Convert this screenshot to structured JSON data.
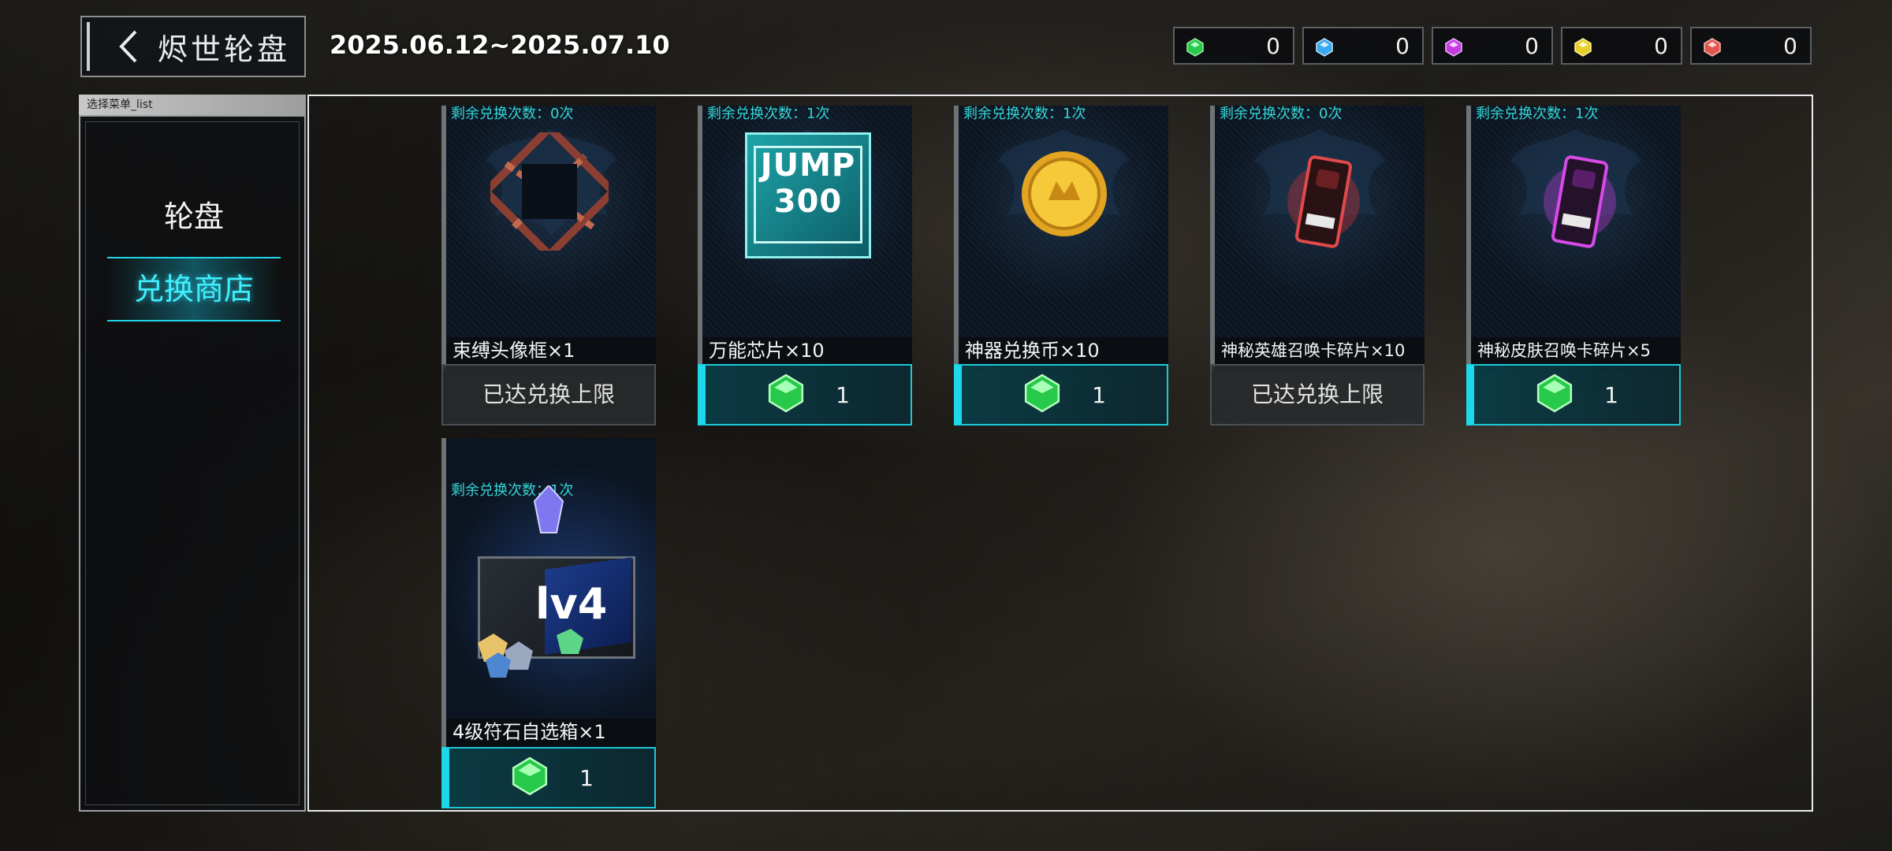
{
  "header": {
    "title": "烬世轮盘",
    "date_range": "2025.06.12~2025.07.10"
  },
  "currencies": [
    {
      "icon": "green-gem-icon",
      "color": "#27c94a",
      "value": "0"
    },
    {
      "icon": "blue-gem-icon",
      "color": "#3aa8f0",
      "value": "0"
    },
    {
      "icon": "purple-gem-icon",
      "color": "#c43ddc",
      "value": "0"
    },
    {
      "icon": "yellow-gem-icon",
      "color": "#e6cf2a",
      "value": "0"
    },
    {
      "icon": "red-gem-icon",
      "color": "#e0564f",
      "value": "0"
    }
  ],
  "sidebar": {
    "header": "选择菜单_list",
    "items": [
      {
        "label": "轮盘",
        "active": false
      },
      {
        "label": "兑换商店",
        "active": true
      }
    ]
  },
  "shop": {
    "items": [
      {
        "name": "束缚头像框×1",
        "remaining": "剩余兑换次数：0次",
        "button": "已达兑换上限",
        "price": null
      },
      {
        "name": "万能芯片×10",
        "remaining": "剩余兑换次数：1次",
        "button": null,
        "price": "1",
        "art_text": "JUMP 300"
      },
      {
        "name": "神器兑换币×10",
        "remaining": "剩余兑换次数：1次",
        "button": null,
        "price": "1"
      },
      {
        "name": "神秘英雄召唤卡碎片×10",
        "remaining": "剩余兑换次数：0次",
        "button": "已达兑换上限",
        "price": null
      },
      {
        "name": "神秘皮肤召唤卡碎片×5",
        "remaining": "剩余兑换次数：1次",
        "button": null,
        "price": "1"
      },
      {
        "name": "4级符石自选箱×1",
        "remaining": "剩余兑换次数：1次",
        "button": null,
        "price": "1",
        "art_text": "lv4"
      }
    ]
  },
  "colors": {
    "accent": "#22d4e6",
    "price_gem": "#27c94a"
  }
}
